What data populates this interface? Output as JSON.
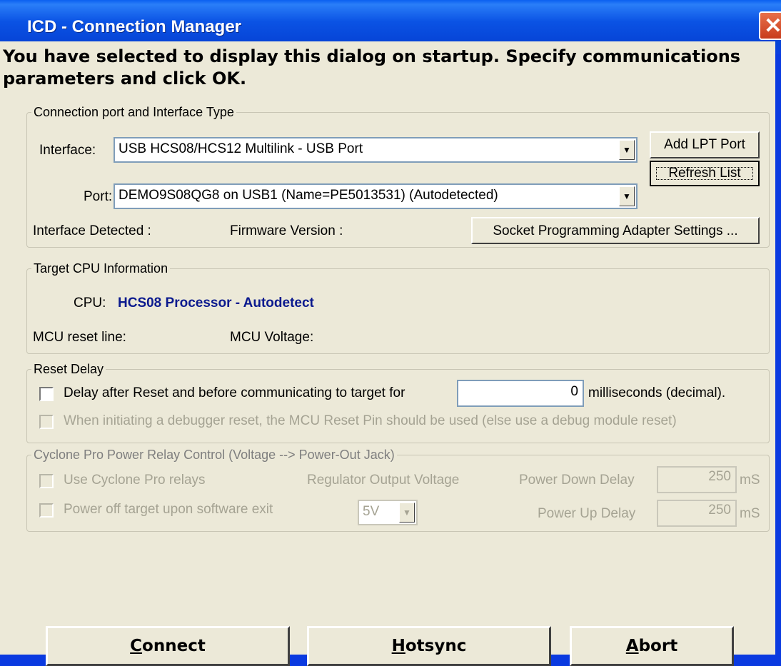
{
  "window": {
    "title": "ICD - Connection Manager",
    "close_glyph": "✕"
  },
  "heading": "You have selected to display this dialog on startup. Specify communications parameters and click OK.",
  "connection_group": {
    "legend": "Connection port and Interface Type",
    "interface_label": "Interface:",
    "interface_value": "USB HCS08/HCS12 Multilink - USB Port",
    "port_label": "Port:",
    "port_value": "DEMO9S08QG8 on USB1 (Name=PE5013531) (Autodetected)",
    "add_lpt_button": "Add LPT Port",
    "refresh_button": "Refresh List",
    "interface_detected_label": "Interface Detected :",
    "firmware_version_label": "Firmware Version :",
    "socket_button": "Socket Programming Adapter Settings ..."
  },
  "cpu_group": {
    "legend": "Target CPU Information",
    "cpu_label": "CPU:",
    "cpu_value": "HCS08 Processor - Autodetect",
    "reset_line_label": "MCU reset line:",
    "voltage_label": "MCU Voltage:"
  },
  "reset_group": {
    "legend": "Reset Delay",
    "delay_checkbox_label": "Delay after Reset and before communicating to target for",
    "delay_value": "0",
    "delay_units": "milliseconds (decimal).",
    "pin_checkbox_label": "When initiating a debugger reset, the MCU Reset Pin should be used (else use a debug module reset)"
  },
  "cyclone_group": {
    "legend": "Cyclone Pro Power Relay Control  (Voltage --> Power-Out Jack)",
    "relays_label": "Use Cyclone Pro relays",
    "power_off_label": "Power off target upon software exit",
    "regulator_label": "Regulator Output Voltage",
    "regulator_value": "5V",
    "power_down_label": "Power Down Delay",
    "power_down_value": "250",
    "power_up_label": "Power Up Delay",
    "power_up_value": "250",
    "ms_unit": "mS"
  },
  "buttons": {
    "connect_first": "C",
    "connect_rest": "onnect",
    "hotsync_first": "H",
    "hotsync_rest": "otsync",
    "abort_first": "A",
    "abort_rest": "bort"
  },
  "icons": {
    "dropdown": "▼"
  },
  "colors": {
    "title_bar": "#0a3ee0",
    "dialog_bg": "#ece9d8",
    "cpu_value_text": "#0b1a8e",
    "close_button": "#d04a28"
  }
}
